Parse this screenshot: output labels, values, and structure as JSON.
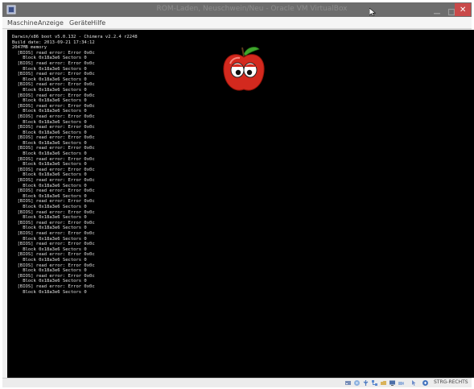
{
  "window": {
    "title": "ROM-Laden, Neuschwein/Neu - Oracle VM VirtualBox",
    "close_glyph": "✕"
  },
  "menubar": {
    "items": [
      "Maschine",
      "Anzeige",
      "Geräte",
      "Hilfe"
    ]
  },
  "console": {
    "lines": [
      "Darwin/x86 boot v5.0.132 - Chimera v2.2.4 r2248",
      "Build date: 2013-09-21 17:34:12",
      "2047MB memory",
      "  [BIOS] read error: Error 0x0c",
      "    Block 0x18a3e6 Sectors 0",
      "  [BIOS] read error: Error 0x0c",
      "    Block 0x18a3e6 Sectors 0",
      "  [BIOS] read error: Error 0x0c",
      "    Block 0x18a3e6 Sectors 0",
      "  [BIOS] read error: Error 0x0c",
      "    Block 0x18a3e6 Sectors 0",
      "  [BIOS] read error: Error 0x0c",
      "    Block 0x18a3e6 Sectors 0",
      "  [BIOS] read error: Error 0x0c",
      "    Block 0x18a3e6 Sectors 0",
      "  [BIOS] read error: Error 0x0c",
      "    Block 0x18a3e6 Sectors 0",
      "  [BIOS] read error: Error 0x0c",
      "    Block 0x18a3e6 Sectors 0",
      "  [BIOS] read error: Error 0x0c",
      "    Block 0x18a3e6 Sectors 0",
      "  [BIOS] read error: Error 0x0c",
      "    Block 0x18a3e6 Sectors 0",
      "  [BIOS] read error: Error 0x0c",
      "    Block 0x18a3e6 Sectors 0",
      "  [BIOS] read error: Error 0x0c",
      "    Block 0x18a3e6 Sectors 0",
      "  [BIOS] read error: Error 0x0c",
      "    Block 0x18a3e6 Sectors 0",
      "  [BIOS] read error: Error 0x0c",
      "    Block 0x18a3e6 Sectors 0",
      "  [BIOS] read error: Error 0x0c",
      "    Block 0x18a3e6 Sectors 0",
      "  [BIOS] read error: Error 0x0c",
      "    Block 0x18a3e6 Sectors 0",
      "  [BIOS] read error: Error 0x0c",
      "    Block 0x18a3e6 Sectors 0",
      "  [BIOS] read error: Error 0x0c",
      "    Block 0x18a3e6 Sectors 0",
      "  [BIOS] read error: Error 0x0c",
      "    Block 0x18a3e6 Sectors 0",
      "  [BIOS] read error: Error 0x0c",
      "    Block 0x18a3e6 Sectors 0",
      "  [BIOS] read error: Error 0x0c",
      "    Block 0x18a3e6 Sectors 0",
      "  [BIOS] read error: Error 0x0c",
      "    Block 0x18a3e6 Sectors 0",
      "  [BIOS] read error: Error 0x0c",
      "    Block 0x18a3e6 Sectors 0"
    ]
  },
  "statusbar": {
    "icons": [
      "hdd-icon",
      "optical-drive-icon",
      "usb-icon",
      "network-icon",
      "shared-folder-icon",
      "display-icon",
      "video-capture-icon",
      "mouse-integration-icon",
      "keyboard-icon"
    ],
    "host_key": "STRG-RECHTS"
  },
  "colors": {
    "title_bar": "#6d6d6d",
    "close_button": "#c94a4a",
    "screen_bg": "#000000",
    "console_text": "#e0e0e0",
    "logo_red": "#d3291e",
    "logo_leaf": "#3fa62c"
  }
}
